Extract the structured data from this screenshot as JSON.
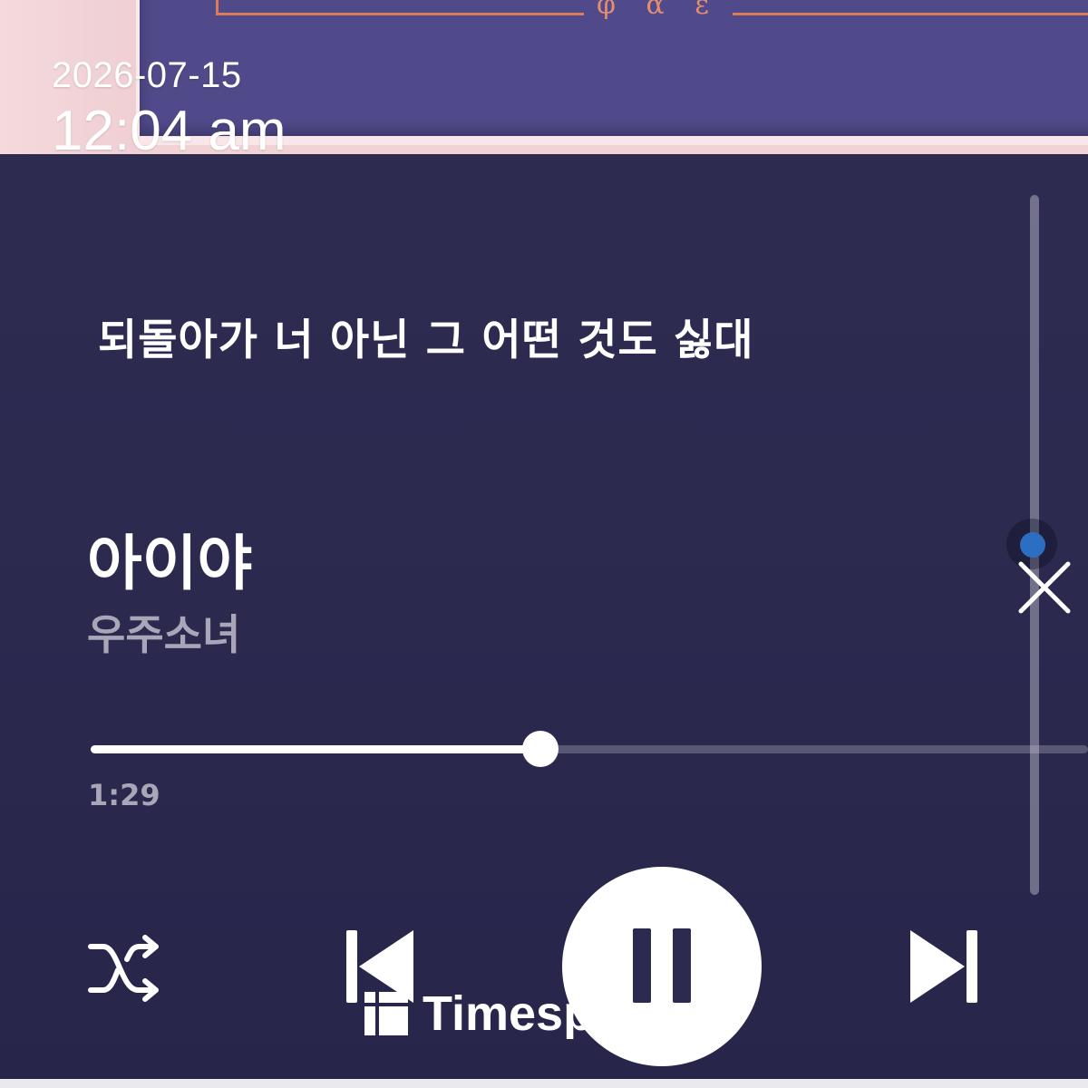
{
  "status": {
    "date": "2026-07-15",
    "time": "12:04 am"
  },
  "album": {
    "symbols": "φ α ε"
  },
  "lyrics": {
    "current_line": "되돌아가 너 아닌 그 어떤 것도 싫대"
  },
  "track": {
    "title": "아이야",
    "artist": "우주소녀"
  },
  "playback": {
    "elapsed": "1:29",
    "progress_fraction": 0.45,
    "state": "playing"
  },
  "watermark": {
    "text": "Timesp"
  },
  "colors": {
    "background": "#2c2a4f",
    "accent_knob": "#2c6fc2",
    "muted_text": "#a8a6b8",
    "album_frame": "#e07b5a"
  },
  "icons": {
    "shuffle": "shuffle-icon",
    "previous": "skip-previous-icon",
    "play_pause": "pause-icon",
    "next": "skip-next-icon",
    "close": "close-icon"
  }
}
